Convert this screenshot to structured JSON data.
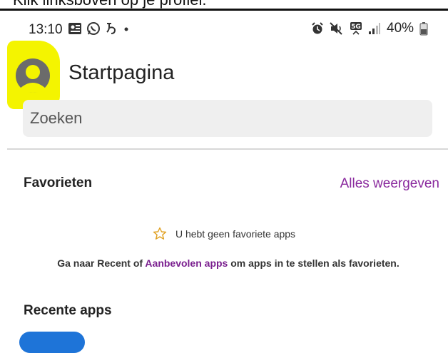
{
  "caption": {
    "text": "Klik linksboven op je profiel."
  },
  "status_bar": {
    "time": "13:10",
    "battery": "40%",
    "left_icons": [
      "gallery-notification-icon",
      "whatsapp-icon",
      "app-notification-icon",
      "more-dot-icon"
    ],
    "right_icons": [
      "alarm-icon",
      "mute-icon",
      "5g-icon",
      "signal-icon",
      "battery-icon"
    ]
  },
  "header": {
    "title": "Startpagina",
    "avatar_icon": "profile-avatar-icon",
    "highlight_color": "#f4f400"
  },
  "search": {
    "placeholder": "Zoeken"
  },
  "favorites": {
    "heading": "Favorieten",
    "see_all": "Alles weergeven",
    "empty_icon": "star-outline-icon",
    "empty_text": "U hebt geen favoriete apps",
    "hint_prefix": "Ga naar Recent of ",
    "hint_link": "Aanbevolen apps",
    "hint_suffix": " om apps in te stellen als favorieten."
  },
  "recent": {
    "heading": "Recente apps"
  },
  "colors": {
    "accent": "#8a2a9e",
    "link": "#7a1f8f"
  }
}
